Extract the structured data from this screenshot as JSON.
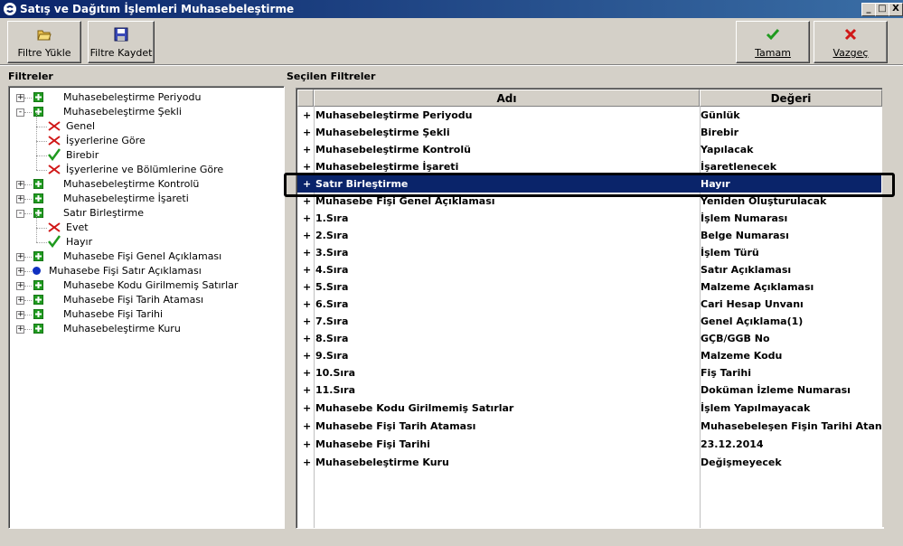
{
  "window": {
    "title": "Satış ve Dağıtım İşlemleri Muhasebeleştirme",
    "minimize_glyph": "_",
    "maximize_glyph": "□",
    "close_glyph": "X"
  },
  "toolbar": {
    "load_filter_label": "Filtre Yükle",
    "save_filter_label": "Filtre Kaydet",
    "ok_label": "Tamam",
    "cancel_label": "Vazgeç"
  },
  "left_panel": {
    "title": "Filtreler",
    "tree": [
      {
        "label": "Muhasebeleştirme Periyodu",
        "level": 0,
        "icon": "plus-green",
        "expander": "+"
      },
      {
        "label": "Muhasebeleştirme Şekli",
        "level": 0,
        "icon": "plus-green",
        "expander": "-"
      },
      {
        "label": "Genel",
        "level": 1,
        "icon": "red-x"
      },
      {
        "label": "İşyerlerine Göre",
        "level": 1,
        "icon": "red-x"
      },
      {
        "label": "Birebir",
        "level": 1,
        "icon": "green-check"
      },
      {
        "label": "İşyerlerine ve Bölümlerine Göre",
        "level": 1,
        "icon": "red-x"
      },
      {
        "label": "Muhasebeleştirme Kontrolü",
        "level": 0,
        "icon": "plus-green",
        "expander": "+"
      },
      {
        "label": "Muhasebeleştirme İşareti",
        "level": 0,
        "icon": "plus-green",
        "expander": "+"
      },
      {
        "label": "Satır Birleştirme",
        "level": 0,
        "icon": "plus-green",
        "expander": "-"
      },
      {
        "label": "Evet",
        "level": 1,
        "icon": "red-x"
      },
      {
        "label": "Hayır",
        "level": 1,
        "icon": "green-check"
      },
      {
        "label": "Muhasebe Fişi Genel Açıklaması",
        "level": 0,
        "icon": "plus-green",
        "expander": "+"
      },
      {
        "label": "Muhasebe Fişi Satır Açıklaması",
        "level": 0,
        "icon": "blue-dot",
        "expander": "+"
      },
      {
        "label": "Muhasebe Kodu Girilmemiş Satırlar",
        "level": 0,
        "icon": "plus-green",
        "expander": "+"
      },
      {
        "label": "Muhasebe Fişi Tarih Ataması",
        "level": 0,
        "icon": "plus-green",
        "expander": "+"
      },
      {
        "label": "Muhasebe Fişi Tarihi",
        "level": 0,
        "icon": "plus-green",
        "expander": "+"
      },
      {
        "label": "Muhasebeleştirme Kuru",
        "level": 0,
        "icon": "plus-green",
        "expander": "+"
      }
    ]
  },
  "right_panel": {
    "title": "Seçilen Filtreler",
    "columns": [
      "Adı",
      "Değeri"
    ],
    "rows": [
      {
        "name": "Muhasebeleştirme Periyodu",
        "value": "Günlük",
        "expander": "+"
      },
      {
        "name": "Muhasebeleştirme Şekli",
        "value": "Birebir",
        "expander": "+"
      },
      {
        "name": "Muhasebeleştirme Kontrolü",
        "value": "Yapılacak",
        "expander": "+"
      },
      {
        "name": "Muhasebeleştirme İşareti",
        "value": "İşaretlenecek",
        "expander": "+"
      },
      {
        "name": "Satır Birleştirme",
        "value": "Hayır",
        "expander": "+",
        "selected": true
      },
      {
        "name": "Muhasebe Fişi Genel Açıklaması",
        "value": "Yeniden Oluşturulacak",
        "expander": "+"
      },
      {
        "name": "1.Sıra",
        "value": "İşlem Numarası",
        "expander": "+"
      },
      {
        "name": "2.Sıra",
        "value": "Belge Numarası",
        "expander": "+"
      },
      {
        "name": "3.Sıra",
        "value": "İşlem Türü",
        "expander": "+"
      },
      {
        "name": "4.Sıra",
        "value": "Satır Açıklaması",
        "expander": "+"
      },
      {
        "name": "5.Sıra",
        "value": "Malzeme Açıklaması",
        "expander": "+"
      },
      {
        "name": "6.Sıra",
        "value": "Cari Hesap Unvanı",
        "expander": "+"
      },
      {
        "name": "7.Sıra",
        "value": "Genel Açıklama(1)",
        "expander": "+"
      },
      {
        "name": "8.Sıra",
        "value": "GÇB/GGB No",
        "expander": "+"
      },
      {
        "name": "9.Sıra",
        "value": "Malzeme Kodu",
        "expander": "+"
      },
      {
        "name": "10.Sıra",
        "value": "Fiş Tarihi",
        "expander": "+"
      },
      {
        "name": "11.Sıra",
        "value": "Doküman İzleme Numarası",
        "expander": "+"
      },
      {
        "name": "Muhasebe Kodu Girilmemiş Satırlar",
        "value": "İşlem Yapılmayacak",
        "expander": "+"
      },
      {
        "name": "Muhasebe Fişi Tarih Ataması",
        "value": "Muhasebeleşen Fişin Tarihi Atanacak",
        "expander": "+"
      },
      {
        "name": "Muhasebe Fişi Tarihi",
        "value": "23.12.2014",
        "expander": "+"
      },
      {
        "name": "Muhasebeleştirme Kuru",
        "value": "Değişmeyecek",
        "expander": "+"
      }
    ]
  },
  "colors": {
    "titlebar": "#0a246a",
    "selected_row": "#0a246a",
    "window_bg": "#d4d0c8",
    "green_icon": "#1f9a1f",
    "red_icon": "#d01818",
    "blue_dot": "#1030c0"
  }
}
